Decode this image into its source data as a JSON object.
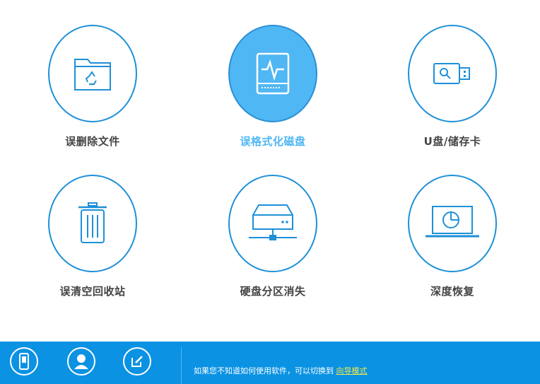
{
  "tiles": [
    {
      "label": "误删除文件",
      "icon": "recycle-folder-icon"
    },
    {
      "label": "误格式化磁盘",
      "icon": "disk-pulse-icon"
    },
    {
      "label": "U盘/储存卡",
      "icon": "usb-drive-icon"
    },
    {
      "label": "误清空回收站",
      "icon": "trash-bin-icon"
    },
    {
      "label": "硬盘分区消失",
      "icon": "network-drive-icon"
    },
    {
      "label": "深度恢复",
      "icon": "laptop-scan-icon"
    }
  ],
  "active_tile": "误格式化磁盘",
  "bottom_bar": {
    "hint_text": "如果您不知道如何使用软件，可以切换到",
    "link_text": "向导模式",
    "buttons": [
      "phone-icon",
      "user-icon",
      "edit-icon"
    ]
  },
  "colors": {
    "accent": "#1e90d8",
    "active_fill": "#4fb7f3",
    "bar": "#0b92e3",
    "link": "#f3e84c"
  }
}
